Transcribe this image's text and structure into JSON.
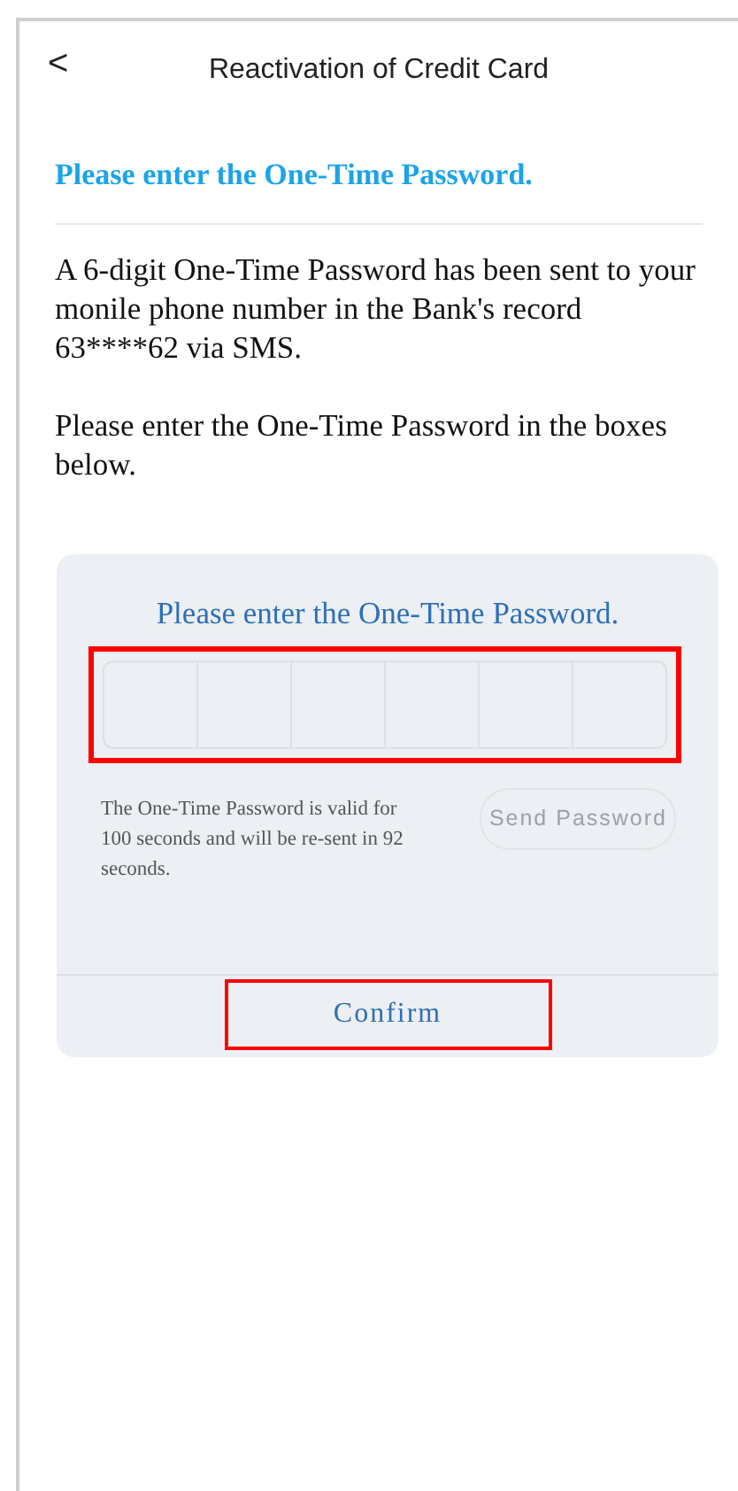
{
  "header": {
    "back": "<",
    "title": "Reactivation of Credit Card"
  },
  "heading": "Please enter the One-Time Password.",
  "paragraphs": [
    "A 6-digit One-Time Password has been sent to your monile phone number in the Bank's record 63****62  via SMS.",
    "Please enter the One-Time Password in the boxes below."
  ],
  "otp_card": {
    "title": "Please enter the One-Time Password.",
    "otp_boxes": {
      "highlighted": true,
      "boxes": [
        {
          "filled": false
        },
        {
          "filled": false
        },
        {
          "filled": false
        },
        {
          "filled": false
        },
        {
          "filled": false
        },
        {
          "filled": false
        }
      ]
    },
    "hint": "The One-Time Password is valid for 100 seconds and will be re-sent in 92 seconds.",
    "send_button": {
      "label": "Send Password",
      "disabled": true
    },
    "confirm_button": {
      "label": "Confirm",
      "highlighted": true
    }
  }
}
